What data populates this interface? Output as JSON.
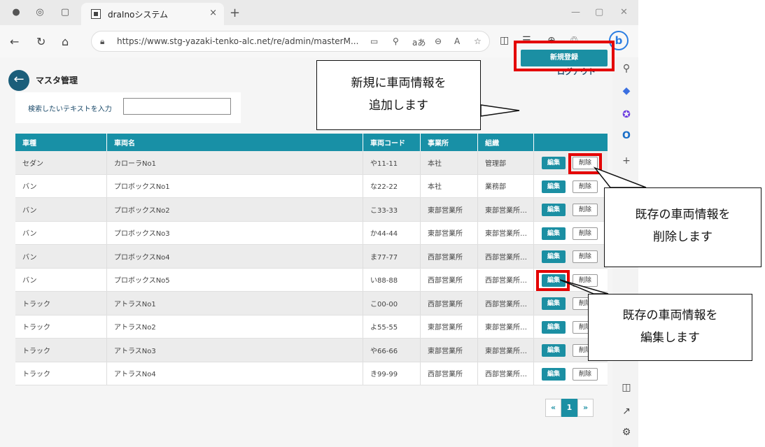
{
  "browser": {
    "tab_title": "draInoシステム",
    "tab_close": "×",
    "new_tab": "+",
    "url": "https://www.stg-yazaki-tenko-alc.net/re/admin/masterM...",
    "zoom_text": "aあ"
  },
  "page": {
    "title": "マスタ管理",
    "logout_label": "ログアウト",
    "search_label": "検索したいテキストを入力",
    "search_value": "",
    "new_button_label": "新規登録"
  },
  "table": {
    "headers": [
      "車種",
      "車両名",
      "車両コード",
      "事業所",
      "組織",
      ""
    ],
    "edit_label": "編集",
    "delete_label": "削除",
    "rows": [
      [
        "セダン",
        "カローラNo1",
        "や11-11",
        "本社",
        "管理部"
      ],
      [
        "バン",
        "プロボックスNo1",
        "な22-22",
        "本社",
        "業務部"
      ],
      [
        "バン",
        "プロボックスNo2",
        "こ33-33",
        "東部営業所",
        "東部営業所…"
      ],
      [
        "バン",
        "プロボックスNo3",
        "か44-44",
        "東部営業所",
        "東部営業所…"
      ],
      [
        "バン",
        "プロボックスNo4",
        "ま77-77",
        "西部営業所",
        "西部営業所…"
      ],
      [
        "バン",
        "プロボックスNo5",
        "い88-88",
        "西部営業所",
        "西部営業所…"
      ],
      [
        "トラック",
        "アトラスNo1",
        "こ00-00",
        "西部営業所",
        "西部営業所…"
      ],
      [
        "トラック",
        "アトラスNo2",
        "よ55-55",
        "東部営業所",
        "東部営業所…"
      ],
      [
        "トラック",
        "アトラスNo3",
        "や66-66",
        "東部営業所",
        "東部営業所…"
      ],
      [
        "トラック",
        "アトラスNo4",
        "き99-99",
        "西部営業所",
        "西部営業所…"
      ]
    ]
  },
  "pager": {
    "prev": "«",
    "current": "1",
    "next": "»"
  },
  "annotations": {
    "add_line1": "新規に車両情報を",
    "add_line2": "追加します",
    "delete_line1": "既存の車両情報を",
    "delete_line2": "削除します",
    "edit_line1": "既存の車両情報を",
    "edit_line2": "編集します"
  },
  "colors": {
    "accent": "#1b8fa3",
    "header": "#1890a6",
    "highlight": "#e40000",
    "back_button": "#1b5e7a"
  }
}
